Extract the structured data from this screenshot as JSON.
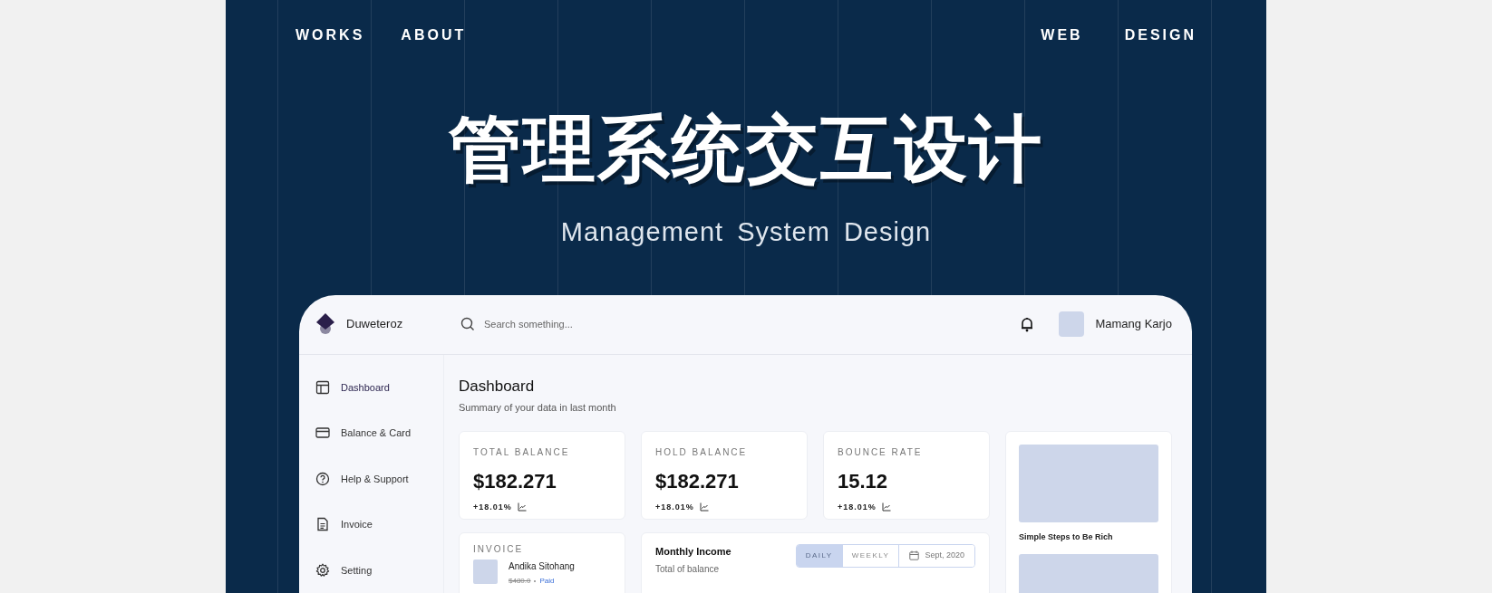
{
  "nav": {
    "left": [
      {
        "label": "WORKS"
      },
      {
        "label": "ABOUT"
      }
    ],
    "right": [
      {
        "label": "WEB"
      },
      {
        "label": "DESIGN"
      }
    ]
  },
  "hero": {
    "title": "管理系统交互设计",
    "subtitle": "Management System Design"
  },
  "app": {
    "brand": "Duweteroz",
    "search": {
      "placeholder": "Search something..."
    },
    "user": {
      "name": "Mamang Karjo"
    },
    "sidebar": {
      "items": [
        {
          "label": "Dashboard",
          "selected": true
        },
        {
          "label": "Balance & Card",
          "selected": false
        },
        {
          "label": "Help & Support",
          "selected": false
        },
        {
          "label": "Invoice",
          "selected": false
        },
        {
          "label": "Setting",
          "selected": false
        }
      ]
    },
    "page": {
      "title": "Dashboard",
      "subtitle": "Summary of your data in last month"
    },
    "stats": [
      {
        "label": "TOTAL BALANCE",
        "value": "$182.271",
        "change": "+18.01%"
      },
      {
        "label": "HOLD BALANCE",
        "value": "$182.271",
        "change": "+18.01%"
      },
      {
        "label": "BOUNCE RATE",
        "value": "15.12",
        "change": "+18.01%"
      }
    ],
    "invoice": {
      "label": "INVOICE",
      "items": [
        {
          "name": "Andika Sitohang",
          "amount": "$480.0",
          "status": "Paid"
        }
      ]
    },
    "income": {
      "title": "Monthly Income",
      "subtitle": "Total of balance",
      "tabs": [
        {
          "label": "DAILY",
          "selected": true
        },
        {
          "label": "WEEKLY",
          "selected": false
        }
      ],
      "date": "Sept, 2020"
    },
    "articles": [
      {
        "kind": "picture",
        "title": "Simple Steps to Be Rich"
      },
      {
        "kind": "picture"
      }
    ]
  }
}
